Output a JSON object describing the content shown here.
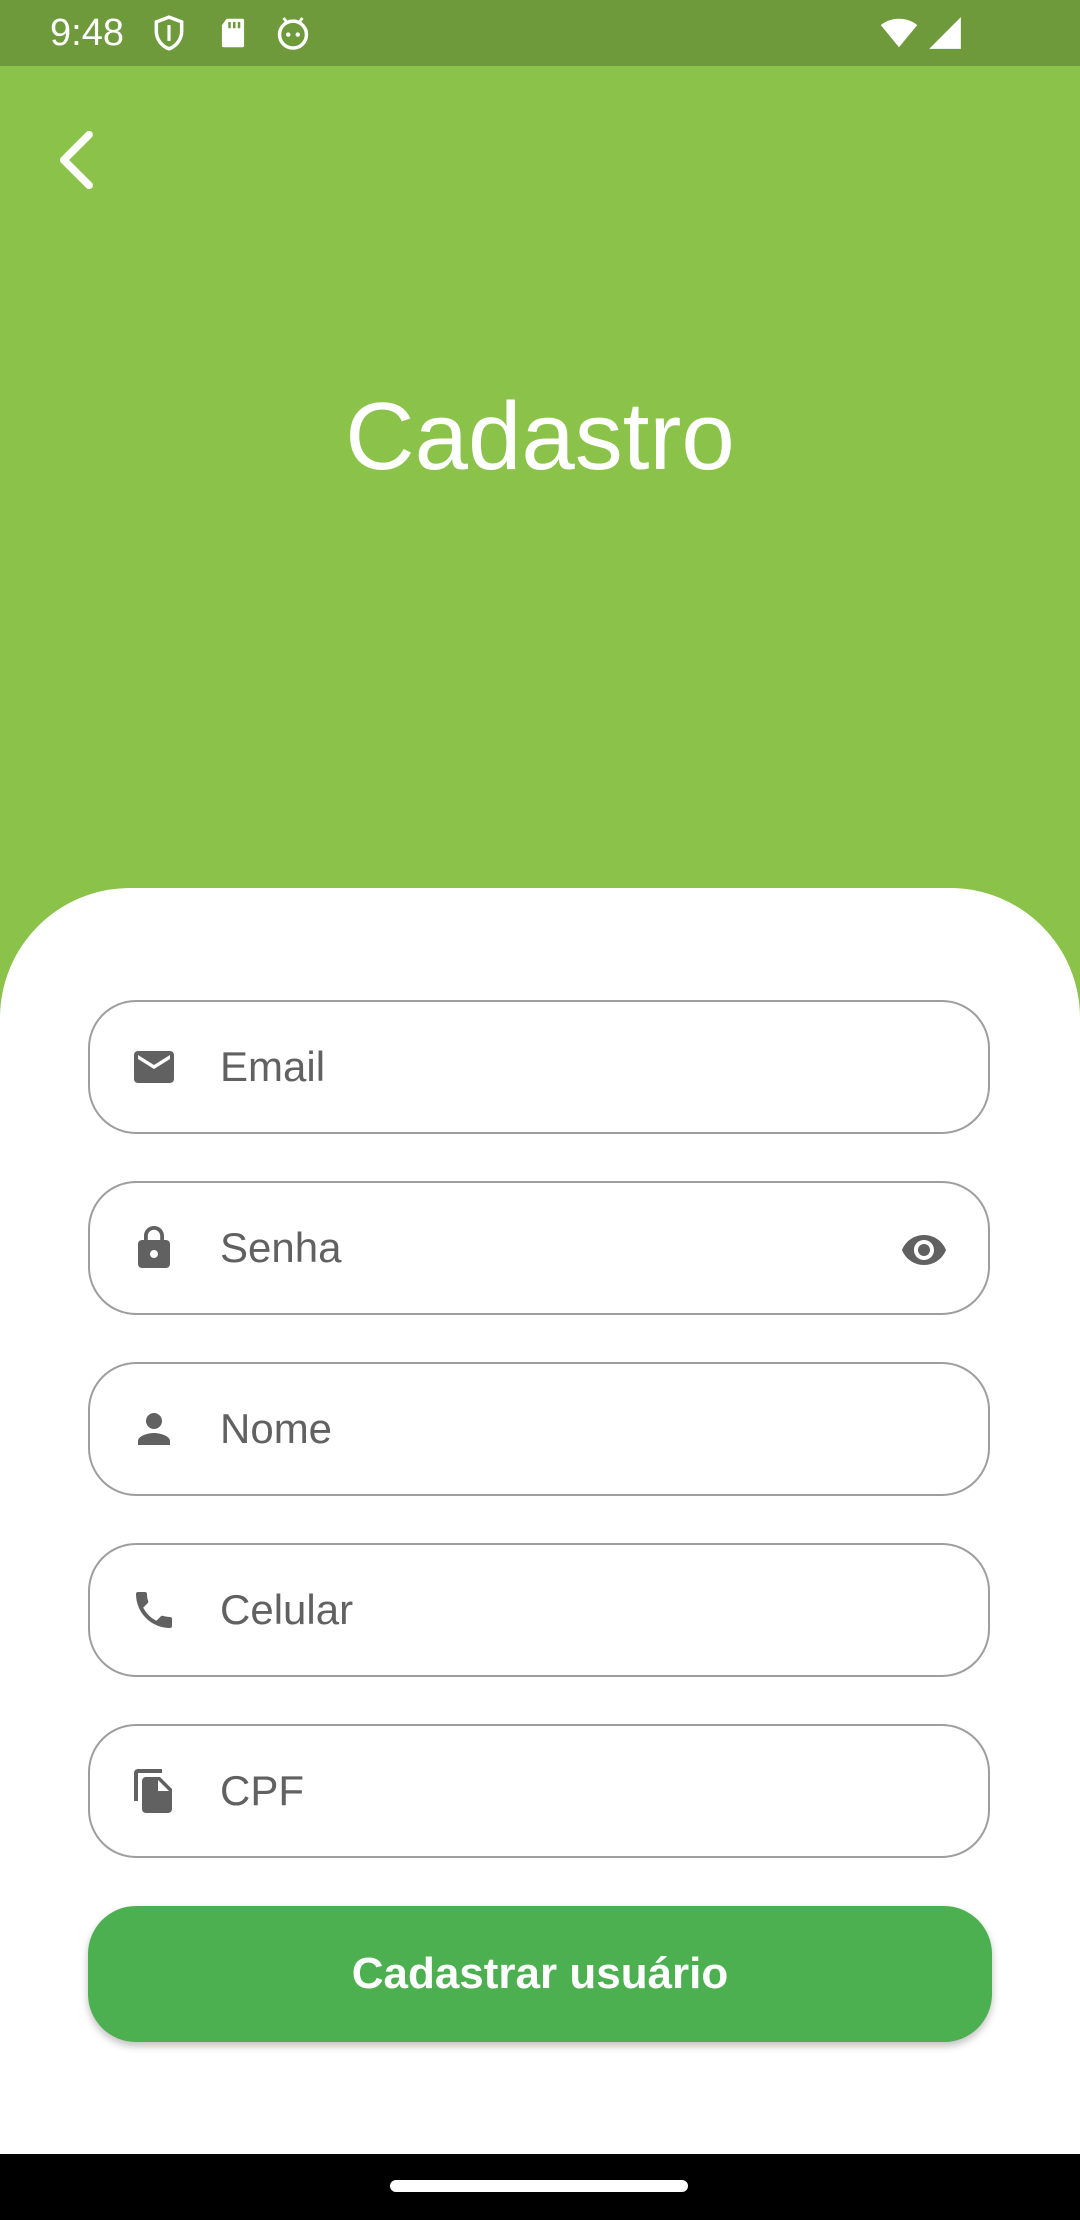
{
  "status_bar": {
    "time": "9:48",
    "icons": [
      "shield-icon",
      "sd-card-icon",
      "android-icon",
      "wifi-icon",
      "signal-icon"
    ]
  },
  "header": {
    "back_icon": "back-arrow-icon",
    "title": "Cadastro"
  },
  "form": {
    "fields": [
      {
        "icon": "email-icon",
        "placeholder": "Email",
        "value": ""
      },
      {
        "icon": "lock-icon",
        "placeholder": "Senha",
        "value": "",
        "trailing_icon": "eye-icon"
      },
      {
        "icon": "person-icon",
        "placeholder": "Nome",
        "value": ""
      },
      {
        "icon": "phone-icon",
        "placeholder": "Celular",
        "value": ""
      },
      {
        "icon": "document-icon",
        "placeholder": "CPF",
        "value": ""
      }
    ],
    "submit_label": "Cadastrar usuário"
  },
  "colors": {
    "header_background": "#8BC34A",
    "status_bar": "#6E9A3B",
    "button": "#4CAF50",
    "field_border": "#9E9E9E",
    "icon": "#616161"
  }
}
